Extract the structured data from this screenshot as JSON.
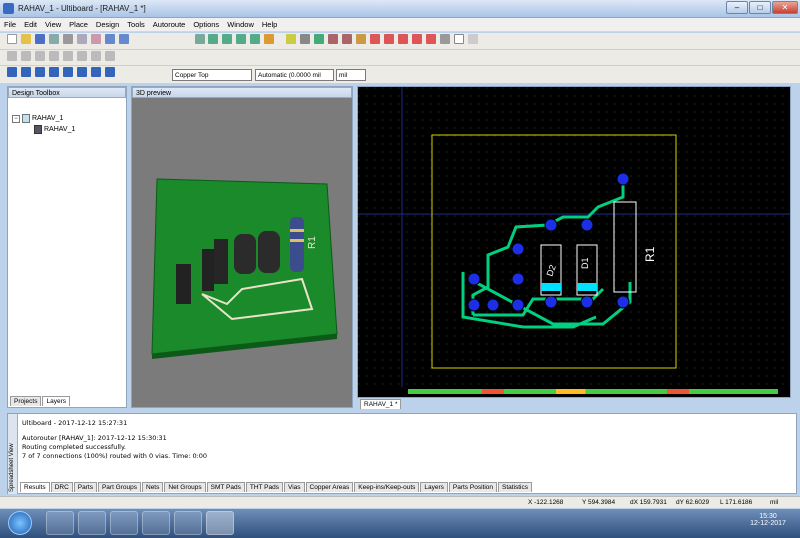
{
  "window": {
    "title": "RAHAV_1 - Ultiboard - [RAHAV_1 *]"
  },
  "menu": [
    "File",
    "Edit",
    "View",
    "Place",
    "Design",
    "Tools",
    "Autoroute",
    "Options",
    "Window",
    "Help"
  ],
  "toolbar": {
    "layer": "Copper Top",
    "width": "Automatic (0.0000 mil",
    "unit": "mil"
  },
  "design_toolbox": {
    "title": "Design Toolbox",
    "tree_root": "RAHAV_1",
    "tree_child": "RAHAV_1",
    "tabs": [
      "Projects",
      "Layers"
    ]
  },
  "preview": {
    "title": "3D preview",
    "component_label": "R1"
  },
  "pcb": {
    "component_labels": [
      "R1",
      "D1",
      "D2"
    ],
    "tab": "RAHAV_1 *"
  },
  "spreadsheet": {
    "side_label": "Spreadsheet View",
    "lines": [
      "Ultiboard  -  2017-12-12 15:27:31",
      "",
      "Autorouter [RAHAV_1]: 2017-12-12 15:30:31",
      "Routing completed successfully.",
      "7 of 7 connections (100%) routed with 0 vias.  Time: 0:00"
    ],
    "tabs": [
      "Results",
      "DRC",
      "Parts",
      "Part Groups",
      "Nets",
      "Net Groups",
      "SMT Pads",
      "THT Pads",
      "Vias",
      "Copper Areas",
      "Keep-ins/Keep-outs",
      "Layers",
      "Parts Position",
      "Statistics"
    ]
  },
  "status": {
    "x": "X -122.1268",
    "y": "Y 594.3984",
    "dx": "dX 159.7931",
    "dy": "dY 62.6029",
    "l": "L 171.6186",
    "unit": "mil"
  },
  "taskbar": {
    "time": "15:30",
    "date": "12-12-2017"
  },
  "colors": {
    "pcb_bg": "#000000",
    "trace": "#00d080",
    "pad": "#1c2fe6",
    "board3d": "#1a8a2a",
    "outline": "#d4d400"
  }
}
